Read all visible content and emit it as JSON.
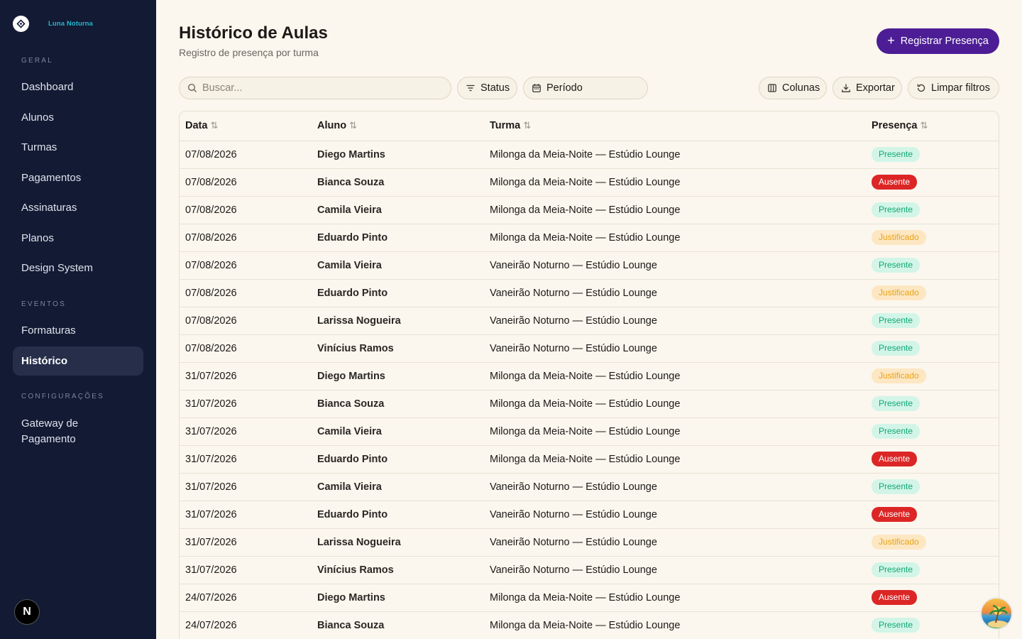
{
  "brand": {
    "name": "Luna Noturna"
  },
  "sidebar": {
    "sections": [
      {
        "label": "GERAL",
        "items": [
          "Dashboard",
          "Alunos",
          "Turmas",
          "Pagamentos",
          "Assinaturas",
          "Planos",
          "Design System"
        ]
      },
      {
        "label": "EVENTOS",
        "items": [
          "Formaturas",
          "Histórico"
        ]
      },
      {
        "label": "CONFIGURAÇÕES",
        "items": [
          "Gateway de Pagamento"
        ]
      }
    ],
    "active": "Histórico",
    "badge": "N"
  },
  "header": {
    "title": "Histórico de Aulas",
    "subtitle": "Registro de presença por turma",
    "primary_action": "Registrar Presença"
  },
  "toolbar": {
    "search_placeholder": "Buscar...",
    "status_label": "Status",
    "periodo_label": "Período",
    "colunas_label": "Colunas",
    "exportar_label": "Exportar",
    "limpar_label": "Limpar filtros"
  },
  "table": {
    "columns": [
      "Data",
      "Aluno",
      "Turma",
      "Presença"
    ],
    "rows": [
      [
        "07/08/2026",
        "Diego Martins",
        "Milonga da Meia-Noite — Estúdio Lounge",
        "Presente"
      ],
      [
        "07/08/2026",
        "Bianca Souza",
        "Milonga da Meia-Noite — Estúdio Lounge",
        "Ausente"
      ],
      [
        "07/08/2026",
        "Camila Vieira",
        "Milonga da Meia-Noite — Estúdio Lounge",
        "Presente"
      ],
      [
        "07/08/2026",
        "Eduardo Pinto",
        "Milonga da Meia-Noite — Estúdio Lounge",
        "Justificado"
      ],
      [
        "07/08/2026",
        "Camila Vieira",
        "Vaneirão Noturno — Estúdio Lounge",
        "Presente"
      ],
      [
        "07/08/2026",
        "Eduardo Pinto",
        "Vaneirão Noturno — Estúdio Lounge",
        "Justificado"
      ],
      [
        "07/08/2026",
        "Larissa Nogueira",
        "Vaneirão Noturno — Estúdio Lounge",
        "Presente"
      ],
      [
        "07/08/2026",
        "Vinícius Ramos",
        "Vaneirão Noturno — Estúdio Lounge",
        "Presente"
      ],
      [
        "31/07/2026",
        "Diego Martins",
        "Milonga da Meia-Noite — Estúdio Lounge",
        "Justificado"
      ],
      [
        "31/07/2026",
        "Bianca Souza",
        "Milonga da Meia-Noite — Estúdio Lounge",
        "Presente"
      ],
      [
        "31/07/2026",
        "Camila Vieira",
        "Milonga da Meia-Noite — Estúdio Lounge",
        "Presente"
      ],
      [
        "31/07/2026",
        "Eduardo Pinto",
        "Milonga da Meia-Noite — Estúdio Lounge",
        "Ausente"
      ],
      [
        "31/07/2026",
        "Camila Vieira",
        "Vaneirão Noturno — Estúdio Lounge",
        "Presente"
      ],
      [
        "31/07/2026",
        "Eduardo Pinto",
        "Vaneirão Noturno — Estúdio Lounge",
        "Ausente"
      ],
      [
        "31/07/2026",
        "Larissa Nogueira",
        "Vaneirão Noturno — Estúdio Lounge",
        "Justificado"
      ],
      [
        "31/07/2026",
        "Vinícius Ramos",
        "Vaneirão Noturno — Estúdio Lounge",
        "Presente"
      ],
      [
        "24/07/2026",
        "Diego Martins",
        "Milonga da Meia-Noite — Estúdio Lounge",
        "Ausente"
      ],
      [
        "24/07/2026",
        "Bianca Souza",
        "Milonga da Meia-Noite — Estúdio Lounge",
        "Presente"
      ]
    ]
  },
  "colors": {
    "sidebar_bg": "#131a33",
    "accent": "#4c1d95",
    "brand": "#22b8cf",
    "presente": "#10a876",
    "ausente": "#dc2626",
    "justificado": "#e8a317"
  },
  "icons": {
    "search": "search-icon",
    "filter": "filter-icon",
    "calendar": "calendar-icon",
    "columns": "columns-icon",
    "download": "download-icon",
    "reset": "reset-icon",
    "sort": "sort-icon",
    "plus": "plus-icon"
  }
}
